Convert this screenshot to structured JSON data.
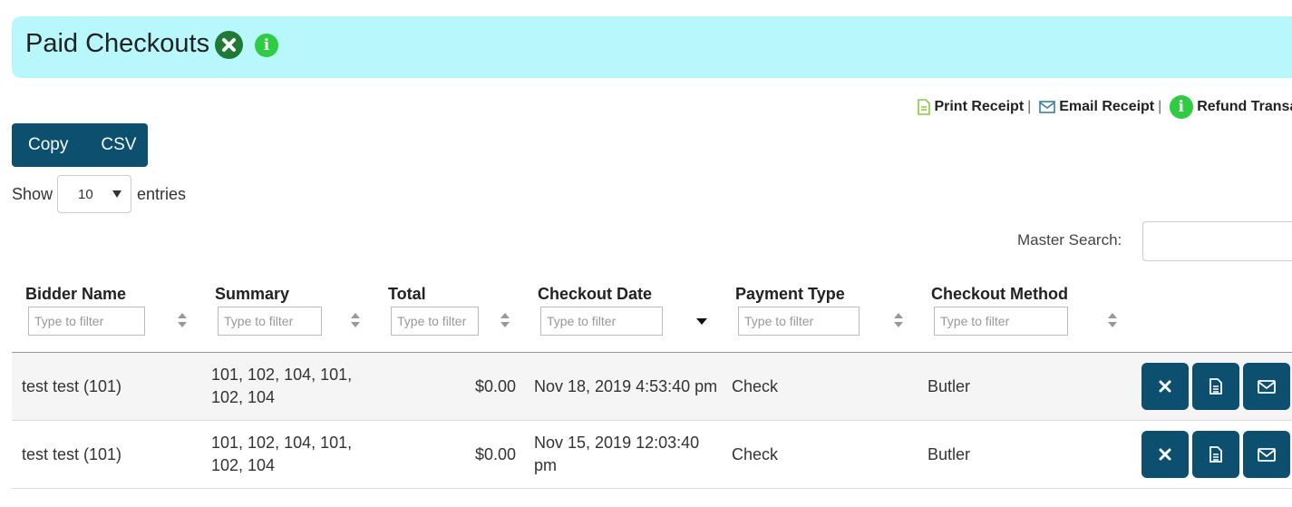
{
  "header": {
    "title": "Paid Checkouts"
  },
  "legend": {
    "print_receipt": "Print Receipt",
    "email_receipt": "Email Receipt",
    "refund": "Refund Transa",
    "separator": "|"
  },
  "buttons": {
    "copy": "Copy",
    "csv": "CSV"
  },
  "entries": {
    "show_label": "Show",
    "value": "10",
    "suffix": "entries"
  },
  "search": {
    "label": "Master Search:",
    "value": ""
  },
  "table": {
    "columns": [
      "Bidder Name",
      "Summary",
      "Total",
      "Checkout Date",
      "Payment Type",
      "Checkout Method"
    ],
    "filter_placeholder": "Type to filter",
    "rows": [
      {
        "bidder": "test test (101)",
        "summary_line1": "101, 102, 104, 101,",
        "summary_line2": "102, 104",
        "total": "$0.00",
        "date_line1": "Nov 18, 2019 4:53:40 pm",
        "date_line2": "",
        "payment": "Check",
        "method": "Butler"
      },
      {
        "bidder": "test test (101)",
        "summary_line1": "101, 102, 104, 101,",
        "summary_line2": "102, 104",
        "total": "$0.00",
        "date_line1": "Nov 15, 2019 12:03:40",
        "date_line2": "pm",
        "payment": "Check",
        "method": "Butler"
      }
    ]
  },
  "colors": {
    "banner": "#b8f8fc",
    "primary": "#0c4f6e",
    "info_green": "#2ecc40",
    "close_green": "#1e7a34",
    "doc_icon": "#8dc63f",
    "mail_icon": "#3a7ca5"
  },
  "icons": [
    "close-circle-icon",
    "info-icon",
    "document-icon",
    "envelope-icon",
    "close-icon",
    "sort-icon",
    "caret-down-icon"
  ]
}
